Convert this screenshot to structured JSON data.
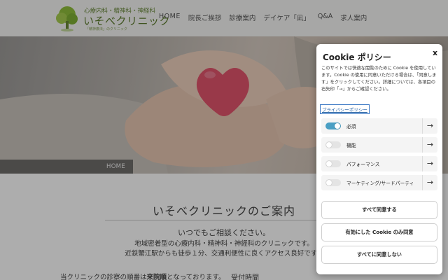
{
  "header": {
    "logo_subtitle": "心療内科・精神科・神経科",
    "logo_name": "いそべクリニック",
    "logo_tagline": "「精神療法」のクリニック",
    "nav": [
      "HOME",
      "院長ご挨拶",
      "診療案内",
      "デイケア「凪」",
      "Q&A",
      "求人案内"
    ]
  },
  "hero": {
    "breadcrumb": "HOME"
  },
  "main": {
    "title": "いそべクリニックのご案内",
    "intro_lead": "いつでもご相談ください。",
    "intro_line1": "地域密着型の心療内科・精神科・神経科のクリニックです。",
    "intro_line2": "近鉄蟹江駅からも徒歩１分、交通利便性に良くアクセス良好です。",
    "note_prefix": "当クリニックの診察の順番は",
    "note_bold": "来院順",
    "note_suffix": "となっております。",
    "reception_label": "受付時間"
  },
  "cookie": {
    "title": "Cookie ポリシー",
    "close": "x",
    "description": "このサイトでは快適な閲覧のために Cookie を使用しています。Cookie の使用に同意いただける場合は、「同意します」をクリックしてください。詳細については、各項目の右矢印「→」からご確認ください。",
    "policy_link": "プライバシーポリシー",
    "categories": [
      {
        "label": "必須",
        "enabled": true
      },
      {
        "label": "機能",
        "enabled": false
      },
      {
        "label": "パフォーマンス",
        "enabled": false
      },
      {
        "label": "マーケティング/サードパーティ",
        "enabled": false
      }
    ],
    "arrow": "→",
    "buttons": {
      "accept_all": "すべて同意する",
      "accept_selected": "有効にした Cookie のみ同意",
      "reject_all": "すべてに同意しない"
    }
  },
  "colors": {
    "accent": "#4a9fc4",
    "logo_green": "#5d7d2e",
    "link": "#1a5aa0"
  }
}
